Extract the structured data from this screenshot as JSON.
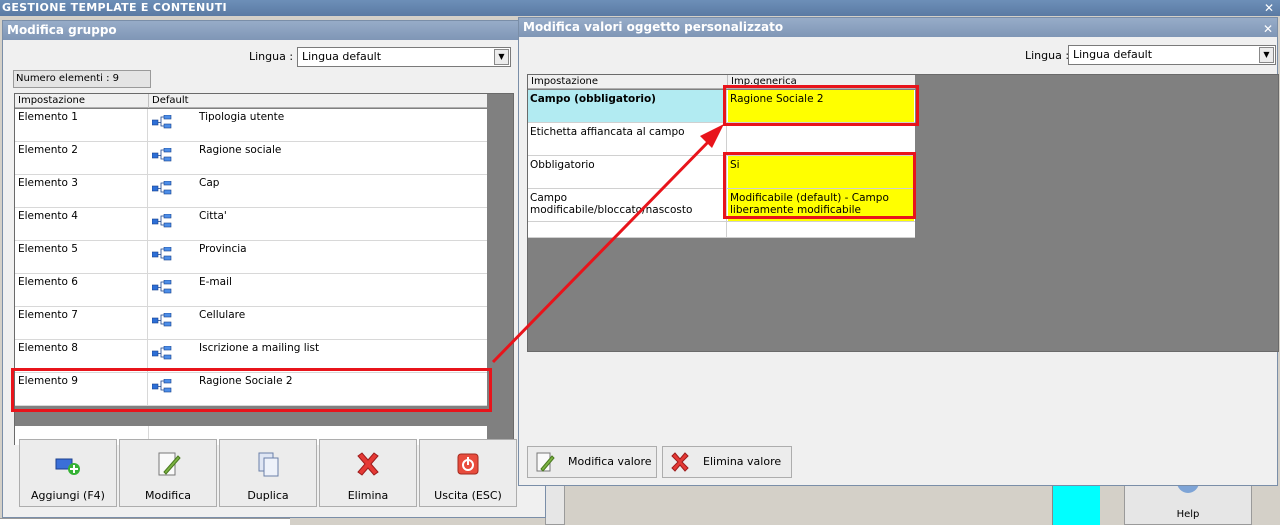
{
  "app": {
    "title": "GESTIONE TEMPLATE E CONTENUTI",
    "close": "✕"
  },
  "left_window": {
    "title": "Modifica gruppo",
    "language_label": "Lingua :",
    "language_value": "Lingua default",
    "count_text": "Numero elementi : 9",
    "columns": [
      "Impostazione",
      "Default"
    ],
    "rows": [
      {
        "name": "Elemento 1",
        "value": "Tipologia utente"
      },
      {
        "name": "Elemento 2",
        "value": "Ragione sociale"
      },
      {
        "name": "Elemento 3",
        "value": "Cap"
      },
      {
        "name": "Elemento 4",
        "value": "Citta'"
      },
      {
        "name": "Elemento 5",
        "value": "Provincia"
      },
      {
        "name": "Elemento 6",
        "value": "E-mail"
      },
      {
        "name": "Elemento 7",
        "value": "Cellulare"
      },
      {
        "name": "Elemento 8",
        "value": "Iscrizione a mailing list"
      },
      {
        "name": "Elemento 9",
        "value": "Ragione Sociale 2"
      }
    ],
    "buttons": [
      "Aggiungi (F4)",
      "Modifica",
      "Duplica",
      "Elimina",
      "Uscita (ESC)"
    ]
  },
  "right_window": {
    "title": "Modifica valori oggetto personalizzato",
    "close": "✕",
    "language_label": "Lingua :",
    "language_value": "Lingua default",
    "columns": [
      "Impostazione",
      "Imp.generica"
    ],
    "rows": [
      {
        "key": "Campo (obbligatorio)",
        "value": "Ragione Sociale 2"
      },
      {
        "key": "Etichetta affiancata al campo",
        "value": ""
      },
      {
        "key": "Obbligatorio",
        "value": "Si"
      },
      {
        "key": "Campo modificabile/bloccato/nascosto",
        "value": "Modificabile (default) - Campo liberamente modificabile"
      }
    ],
    "buttons": [
      "Modifica valore",
      "Elimina valore"
    ]
  },
  "background": {
    "help_label": "Help"
  },
  "colors": {
    "highlight_yellow": "#ffff00",
    "key_cyan": "#b2ebf2",
    "annotation_red": "#e8141b",
    "cyan_block": "#00ffff"
  }
}
